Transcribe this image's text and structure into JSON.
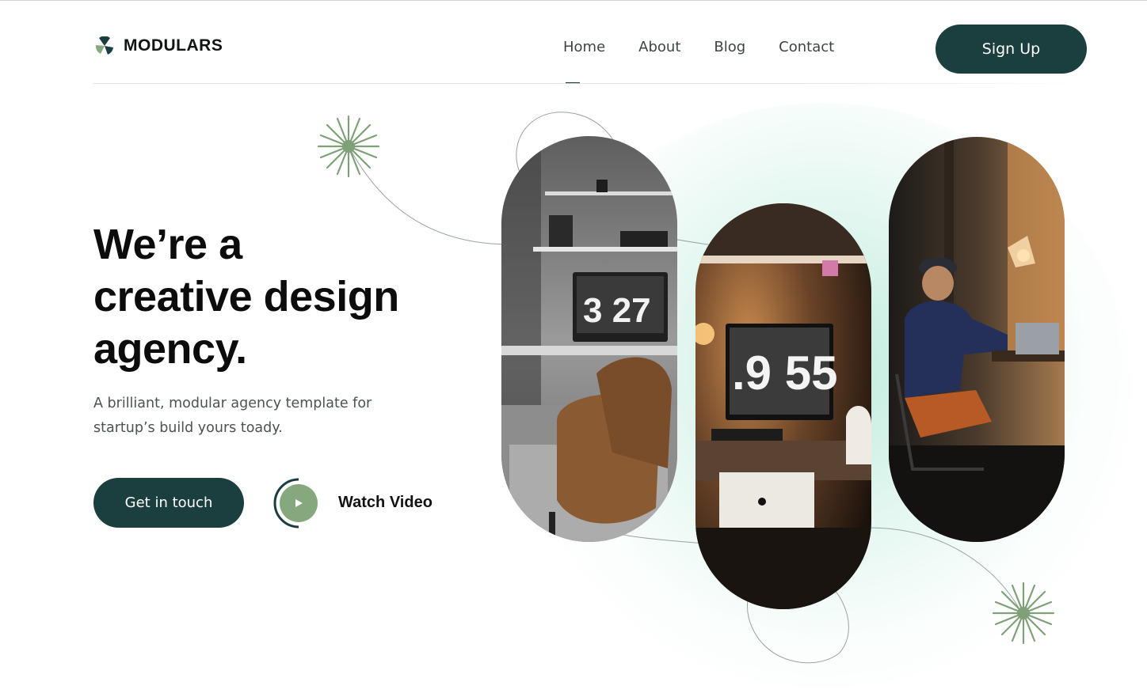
{
  "brand": {
    "name": "MODULARS",
    "accent": "#1a3f3e",
    "sage": "#86a87f"
  },
  "nav": {
    "items": [
      {
        "label": "Home",
        "active": true
      },
      {
        "label": "About"
      },
      {
        "label": "Blog"
      },
      {
        "label": "Contact"
      }
    ],
    "signup_label": "Sign Up"
  },
  "hero": {
    "headline": [
      "We’re a",
      "creative design",
      "agency."
    ],
    "subtext": "A brilliant, modular agency template for startup’s build yours toady.",
    "cta_label": "Get in touch",
    "video_label": "Watch Video"
  },
  "photos": [
    {
      "icon": "photo-desk-gray",
      "clock": "3 27"
    },
    {
      "icon": "photo-desk-warm",
      "clock": ".9 55"
    },
    {
      "icon": "photo-man-laptop"
    }
  ],
  "icons": [
    "modulars-logo-icon",
    "play-icon",
    "starburst-icon"
  ]
}
